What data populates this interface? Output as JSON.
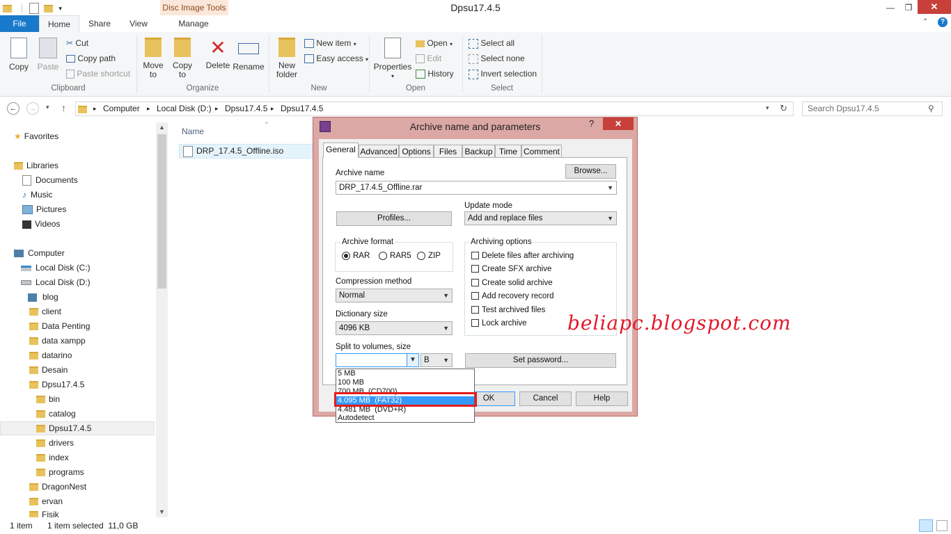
{
  "window": {
    "title": "Dpsu17.4.5",
    "context_tab": "Disc Image Tools"
  },
  "ribbon_tabs": [
    "File",
    "Home",
    "Share",
    "View",
    "Manage"
  ],
  "ribbon": {
    "clipboard": {
      "copy": "Copy",
      "paste": "Paste",
      "cut": "Cut",
      "copy_path": "Copy path",
      "paste_shortcut": "Paste shortcut",
      "label": "Clipboard"
    },
    "organize": {
      "move_to": "Move to",
      "copy_to": "Copy to",
      "delete": "Delete",
      "rename": "Rename",
      "label": "Organize"
    },
    "new": {
      "new_folder": "New folder",
      "new_item": "New item",
      "easy_access": "Easy access",
      "label": "New"
    },
    "open": {
      "properties": "Properties",
      "open": "Open",
      "edit": "Edit",
      "history": "History",
      "label": "Open"
    },
    "select": {
      "select_all": "Select all",
      "select_none": "Select none",
      "invert": "Invert selection",
      "label": "Select"
    }
  },
  "address": {
    "crumbs": [
      "Computer",
      "Local Disk (D:)",
      "Dpsu17.4.5",
      "Dpsu17.4.5"
    ],
    "search_placeholder": "Search Dpsu17.4.5"
  },
  "nav": {
    "favorites": "Favorites",
    "libraries": "Libraries",
    "library_items": [
      "Documents",
      "Music",
      "Pictures",
      "Videos"
    ],
    "computer": "Computer",
    "drives": [
      "Local Disk (C:)",
      "Local Disk (D:)"
    ],
    "d_folders": [
      "blog",
      "client",
      "Data Penting",
      "data xampp",
      "datarino",
      "Desain",
      "Dpsu17.4.5"
    ],
    "dpsu_folders": [
      "bin",
      "catalog",
      "Dpsu17.4.5",
      "drivers",
      "index",
      "programs"
    ],
    "more_folders": [
      "DragonNest",
      "ervan",
      "Fisik"
    ]
  },
  "file_list": {
    "column": "Name",
    "files": [
      "DRP_17.4.5_Offline.iso"
    ]
  },
  "status": {
    "items": "1 item",
    "selected": "1 item selected  11,0 GB"
  },
  "dialog": {
    "title": "Archive name and parameters",
    "help_char": "?",
    "tabs": [
      "General",
      "Advanced",
      "Options",
      "Files",
      "Backup",
      "Time",
      "Comment"
    ],
    "archive_name_label": "Archive name",
    "archive_name_value": "DRP_17.4.5_Offline.rar",
    "browse": "Browse...",
    "profiles": "Profiles...",
    "update_mode_label": "Update mode",
    "update_mode_value": "Add and replace files",
    "archive_format_label": "Archive format",
    "formats": [
      "RAR",
      "RAR5",
      "ZIP"
    ],
    "compression_label": "Compression method",
    "compression_value": "Normal",
    "dictionary_label": "Dictionary size",
    "dictionary_value": "4096 KB",
    "split_label": "Split to volumes, size",
    "split_unit": "B",
    "set_password": "Set password...",
    "archiving_options_label": "Archiving options",
    "options": [
      "Delete files after archiving",
      "Create SFX archive",
      "Create solid archive",
      "Add recovery record",
      "Test archived files",
      "Lock archive"
    ],
    "ok": "OK",
    "cancel": "Cancel",
    "help": "Help",
    "split_options": [
      "5 MB",
      "100 MB",
      "700 MB  (CD700)",
      "4.095 MB  (FAT32)",
      "4.481 MB  (DVD+R)",
      "Autodetect"
    ]
  },
  "watermark": "beliapc.blogspot.com",
  "colors": {
    "file_tab": "#1979ca",
    "highlight": "#3399ff",
    "red_box": "#e51b1b",
    "watermark": "#e3192b",
    "dialog_frame": "#dba8a5"
  }
}
